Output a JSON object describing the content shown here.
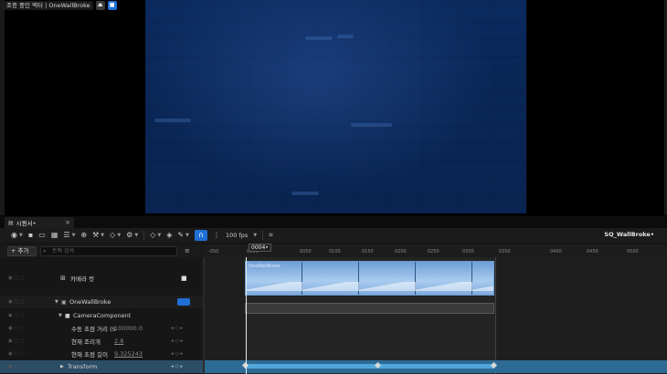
{
  "viewport": {
    "pilot_label": "조종 중인 액터 | OneWallBroke",
    "eject_glyph": "⏏",
    "camera_glyph": "■"
  },
  "sequencer": {
    "tab_label": "시퀀서•",
    "tab_close": "×",
    "sequence_name": "SQ_WallBroke•",
    "toolbar": {
      "fps": "100 fps",
      "snap_glyph": "∩"
    },
    "add_label": "+ 추가",
    "search_placeholder": "트랙 검색",
    "playhead_value": "0004•",
    "ruler_ticks": [
      "-050",
      "0000",
      "0050",
      "0100",
      "0150",
      "0200",
      "0250",
      "0300",
      "0350",
      "0400",
      "0450",
      "0500"
    ],
    "tracks": [
      {
        "label": "카메라 컷"
      },
      {
        "label": "OneWallBroke"
      },
      {
        "label": "CameraComponent"
      },
      {
        "label": "수동 초점 거리 (S",
        "value": "100000.0"
      },
      {
        "label": "현재 조리개",
        "value": "2.8"
      },
      {
        "label": "현재 초점 길이",
        "value": "9.325243"
      },
      {
        "label": "Transform"
      }
    ],
    "shot_label": "OneWallBroke"
  },
  "colors": {
    "accent": "#1f6fd6",
    "transform_lane": "#2d6b95"
  }
}
